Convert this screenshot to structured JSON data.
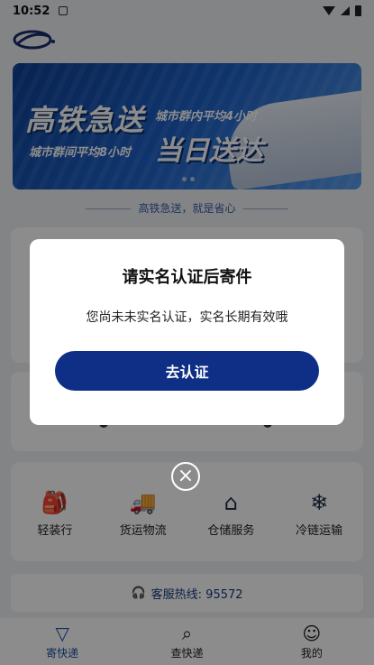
{
  "status_bar": {
    "time": "10:52"
  },
  "banner": {
    "headline_left": "高铁急送",
    "subline_top": "城市群内平均4小时",
    "subline_bottom": "城市群间平均8小时",
    "headline_right": "当日送达"
  },
  "slogan": "高铁急送，就是省心",
  "services": [
    {
      "label": "轻装行",
      "icon": "backpack-icon",
      "glyph": "🎒"
    },
    {
      "label": "货运物流",
      "icon": "truck-icon",
      "glyph": "🚚"
    },
    {
      "label": "仓储服务",
      "icon": "warehouse-icon",
      "glyph": "⌂"
    },
    {
      "label": "冷链运输",
      "icon": "snowflake-icon",
      "glyph": "❄"
    }
  ],
  "hotline": {
    "text": "客服热线: 95572",
    "icon": "headset-icon"
  },
  "tabs": [
    {
      "label": "寄快递",
      "icon": "send-icon",
      "glyph": "▽",
      "active": true
    },
    {
      "label": "查快递",
      "icon": "search-icon",
      "glyph": "⌕",
      "active": false
    },
    {
      "label": "我的",
      "icon": "smile-icon",
      "glyph": "☺",
      "active": false
    }
  ],
  "dialog": {
    "title": "请实名认证后寄件",
    "message": "您尚未未实名认证，实名长期有效哦",
    "button": "去认证"
  },
  "colors": {
    "primary": "#0f2f86",
    "accent": "#1b4fa3"
  }
}
